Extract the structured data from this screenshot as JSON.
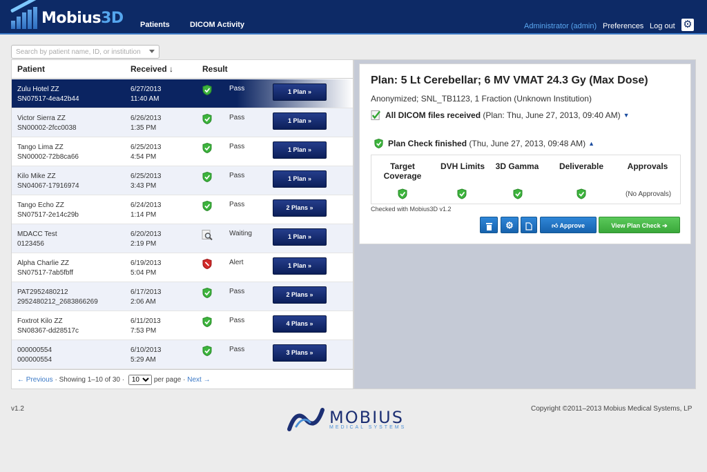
{
  "header": {
    "logo_text_a": "Mobius",
    "logo_text_b": "3D",
    "nav": [
      "Patients",
      "DICOM Activity"
    ],
    "user": "Administrator (admin)",
    "preferences": "Preferences",
    "logout": "Log out",
    "settings_icon": "gear-icon"
  },
  "search": {
    "placeholder": "Search by patient name, ID, or institution"
  },
  "list": {
    "columns": {
      "patient": "Patient",
      "received": "Received ↓",
      "result": "Result"
    },
    "rows": [
      {
        "name": "Zulu Hotel ZZ",
        "id": "SN07517-4ea42b44",
        "date": "6/27/2013",
        "time": "11:40 AM",
        "result": "Pass",
        "icon": "pass-shield-icon",
        "plans": "1 Plan »"
      },
      {
        "name": "Victor Sierra ZZ",
        "id": "SN00002-2fcc0038",
        "date": "6/26/2013",
        "time": "1:35 PM",
        "result": "Pass",
        "icon": "pass-shield-icon",
        "plans": "1 Plan »"
      },
      {
        "name": "Tango Lima ZZ",
        "id": "SN00002-72b8ca66",
        "date": "6/25/2013",
        "time": "4:54 PM",
        "result": "Pass",
        "icon": "pass-shield-icon",
        "plans": "1 Plan »"
      },
      {
        "name": "Kilo Mike ZZ",
        "id": "SN04067-17916974",
        "date": "6/25/2013",
        "time": "3:43 PM",
        "result": "Pass",
        "icon": "pass-shield-icon",
        "plans": "1 Plan »"
      },
      {
        "name": "Tango Echo ZZ",
        "id": "SN07517-2e14c29b",
        "date": "6/24/2013",
        "time": "1:14 PM",
        "result": "Pass",
        "icon": "pass-shield-icon",
        "plans": "2 Plans »"
      },
      {
        "name": "MDACC Test",
        "id": "0123456",
        "date": "6/20/2013",
        "time": "2:19 PM",
        "result": "Waiting",
        "icon": "waiting-magnifier-icon",
        "plans": "1 Plan »"
      },
      {
        "name": "Alpha Charlie ZZ",
        "id": "SN07517-7ab5fbff",
        "date": "6/19/2013",
        "time": "5:04 PM",
        "result": "Alert",
        "icon": "alert-shield-icon",
        "plans": "1 Plan »"
      },
      {
        "name": "PAT2952480212",
        "id": "2952480212_2683866269",
        "date": "6/17/2013",
        "time": "2:06 AM",
        "result": "Pass",
        "icon": "pass-shield-icon",
        "plans": "2 Plans »"
      },
      {
        "name": "Foxtrot Kilo ZZ",
        "id": "SN08367-dd28517c",
        "date": "6/11/2013",
        "time": "7:53 PM",
        "result": "Pass",
        "icon": "pass-shield-icon",
        "plans": "4 Plans »"
      },
      {
        "name": "000000554",
        "id": "000000554",
        "date": "6/10/2013",
        "time": "5:29 AM",
        "result": "Pass",
        "icon": "pass-shield-icon",
        "plans": "3 Plans »"
      }
    ],
    "pager": {
      "previous": "← Previous",
      "showing": "· Showing 1–10 of 30 ·",
      "per_page_value": "10",
      "per_page_label": "per page ·",
      "next": "Next →"
    }
  },
  "plan": {
    "title": "Plan: 5 Lt Cerebellar; 6 MV VMAT 24.3 Gy (Max Dose)",
    "subtitle": "Anonymized; SNL_TB1123, 1 Fraction (Unknown Institution)",
    "dicom_status": "All DICOM files received",
    "dicom_detail": "(Plan: Thu, June 27, 2013, 09:40 AM)",
    "dicom_toggle": "▼",
    "check_status": "Plan Check finished",
    "check_detail": "(Thu, June 27, 2013, 09:48 AM)",
    "check_toggle": "▲",
    "result_columns": [
      "Target Coverage",
      "DVH Limits",
      "3D Gamma",
      "Deliverable",
      "Approvals"
    ],
    "no_approvals": "(No Approvals)",
    "checked_with": "Checked with Mobius3D v1.2",
    "buttons": {
      "delete_icon": "trash-icon",
      "settings_icon": "gear-icon",
      "document_icon": "document-icon",
      "approve": "Approve",
      "view": "View Plan Check"
    }
  },
  "footer": {
    "version": "v1.2",
    "logo_word": "MOBIUS",
    "logo_sub": "MEDICAL SYSTEMS",
    "copyright": "Copyright ©2011–2013 Mobius Medical Systems, LP"
  },
  "colors": {
    "header_bg": "#0d2a66",
    "accent_blue": "#2f86d8",
    "success_green": "#3aa83a",
    "alert_red": "#c62020"
  }
}
